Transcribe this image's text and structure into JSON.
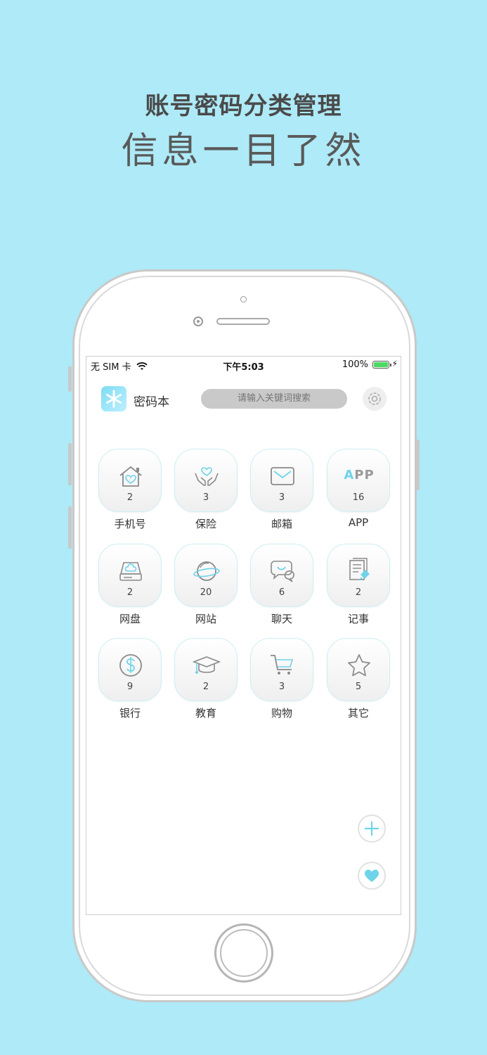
{
  "promo": {
    "line1": "账号密码分类管理",
    "line2": "信息一目了然"
  },
  "status_bar": {
    "carrier": "无 SIM 卡",
    "time": "下午5:03",
    "battery": "100%"
  },
  "header": {
    "app_title": "密码本",
    "search_placeholder": "请输入关键词搜索"
  },
  "categories": [
    {
      "label": "手机号",
      "count": "2",
      "icon": "house-heart-icon"
    },
    {
      "label": "保险",
      "count": "3",
      "icon": "hands-heart-icon"
    },
    {
      "label": "邮箱",
      "count": "3",
      "icon": "mail-icon"
    },
    {
      "label": "APP",
      "count": "16",
      "icon": "app-text-icon",
      "icon_text": "APP"
    },
    {
      "label": "网盘",
      "count": "2",
      "icon": "cloud-drive-icon"
    },
    {
      "label": "网站",
      "count": "20",
      "icon": "planet-icon"
    },
    {
      "label": "聊天",
      "count": "6",
      "icon": "chat-bubbles-icon"
    },
    {
      "label": "记事",
      "count": "2",
      "icon": "notes-pin-icon"
    },
    {
      "label": "银行",
      "count": "9",
      "icon": "dollar-coin-icon"
    },
    {
      "label": "教育",
      "count": "2",
      "icon": "graduation-cap-icon"
    },
    {
      "label": "购物",
      "count": "3",
      "icon": "shopping-cart-icon"
    },
    {
      "label": "其它",
      "count": "5",
      "icon": "star-icon"
    }
  ],
  "colors": {
    "background": "#aeeaf7",
    "accent": "#6fd3ea",
    "icon_gray": "#8a8a8a"
  }
}
